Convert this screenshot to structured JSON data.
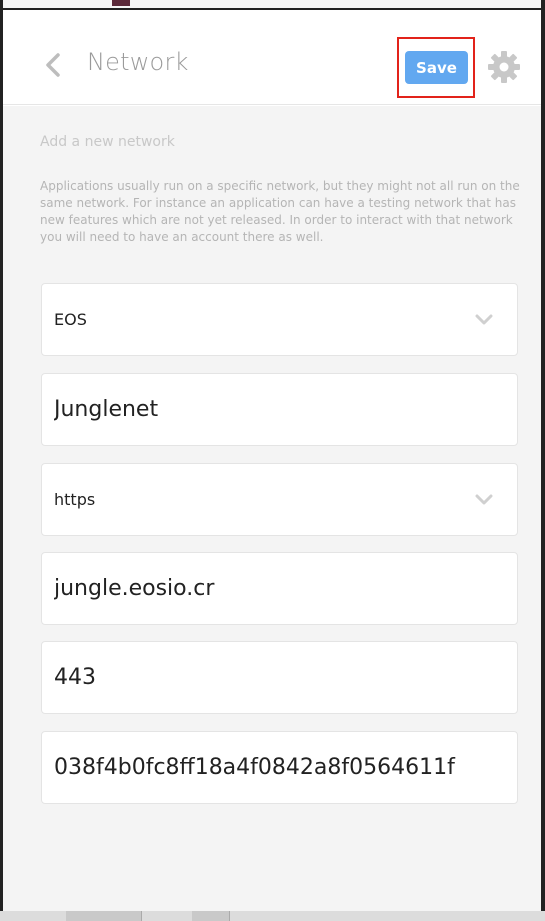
{
  "header": {
    "title": "Network",
    "save_label": "Save"
  },
  "intro": {
    "title": "Add a new network",
    "description": "Applications usually run on a specific network, but they might not all run on the same network. For instance an application can have a testing network that has new features which are not yet released. In order to interact with that network you will need to have an account there as well."
  },
  "form": {
    "blockchain": "EOS",
    "name": "Junglenet",
    "protocol": "https",
    "host": "jungle.eosio.cr",
    "port": "443",
    "chain_id": "038f4b0fc8ff18a4f0842a8f0564611f"
  },
  "colors": {
    "accent": "#62a8f0",
    "highlight": "#e2231a",
    "background": "#f4f4f4"
  },
  "icons": {
    "back": "chevron-left-icon",
    "settings": "gear-icon",
    "dropdown": "chevron-down-icon"
  }
}
